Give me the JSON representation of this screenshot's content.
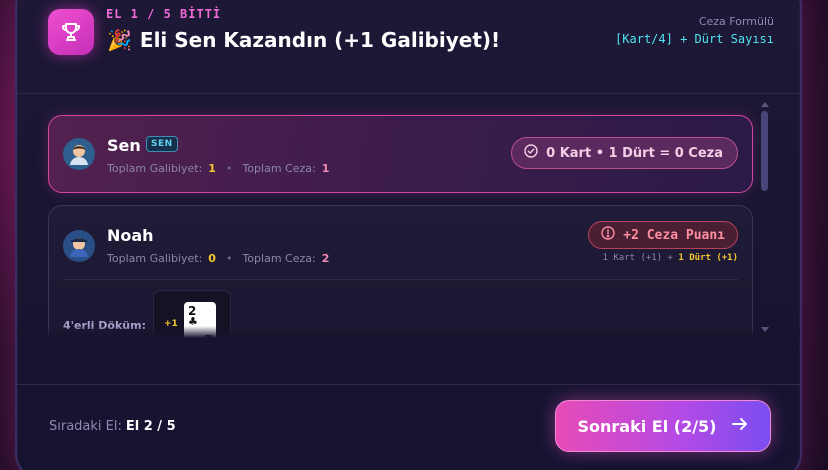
{
  "header": {
    "round_label": "EL 1 / 5 BİTTİ",
    "title": "Eli Sen Kazandın (+1 Galibiyet)!",
    "formula_label": "Ceza Formülü",
    "formula": "[Kart/4] + Dürt Sayısı"
  },
  "players": [
    {
      "name": "Sen",
      "badge": "SEN",
      "stat_win_label": "Toplam Galibiyet:",
      "stat_win_value": "1",
      "stat_pen_label": "Toplam Ceza:",
      "stat_pen_value": "1",
      "result_text": "0 Kart • 1 Dürt = 0 Ceza"
    },
    {
      "name": "Noah",
      "stat_win_label": "Toplam Galibiyet:",
      "stat_win_value": "0",
      "stat_pen_label": "Toplam Ceza:",
      "stat_pen_value": "2",
      "penalty_text": "+2 Ceza Puanı",
      "breakdown_cards": "1 Kart (+1) +",
      "breakdown_durt": "1 Dürt (+1)",
      "dump_label": "4'erli Döküm:",
      "dump_bonus": "+1",
      "card": {
        "rank": "2",
        "suit": "♣"
      }
    }
  ],
  "footer": {
    "next_label": "Sıradaki El:",
    "next_value": "El 2 / 5",
    "next_button": "Sonraki El (2/5)"
  },
  "colors": {
    "accent_pink": "#e84bb6",
    "accent_cyan": "#4fe3ef",
    "gold": "#f5c830",
    "penalty_red": "#ff8ea0"
  }
}
